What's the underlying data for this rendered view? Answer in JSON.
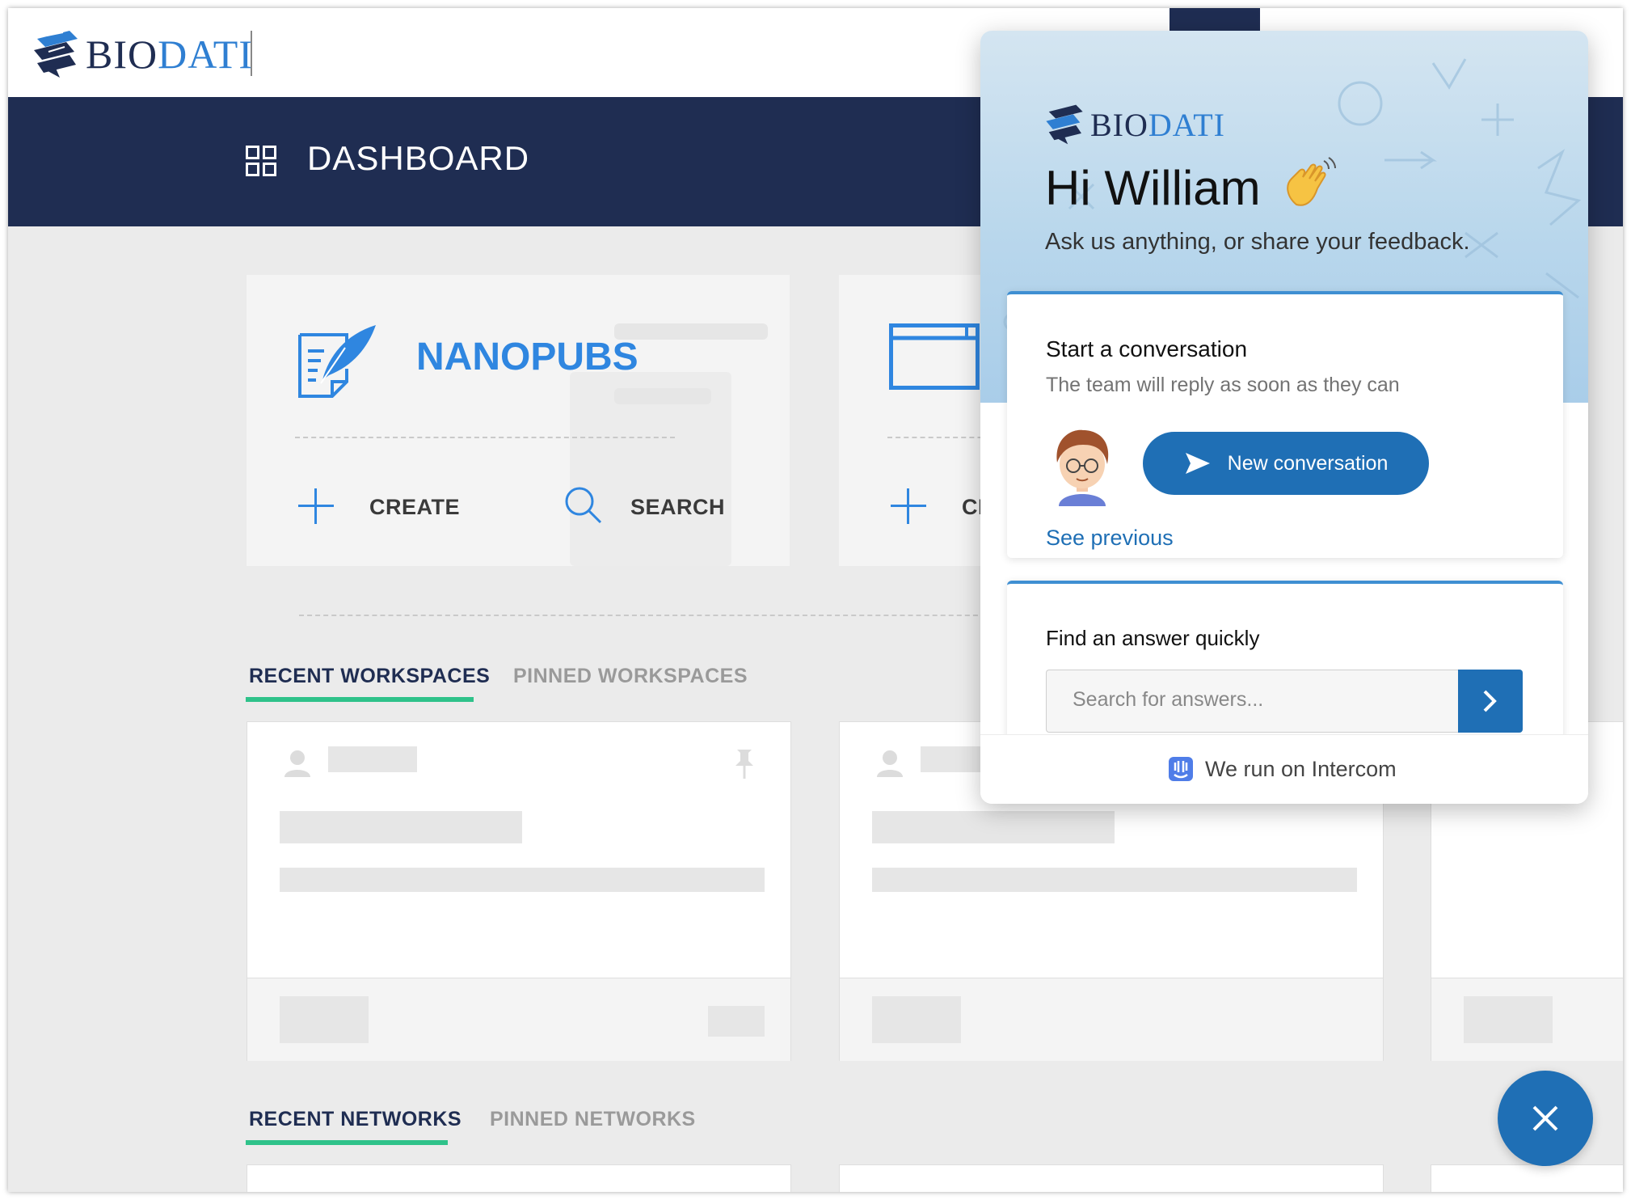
{
  "app": {
    "brand_part1": "BIO",
    "brand_part2": "DATI"
  },
  "header": {
    "title": "DASHBOARD"
  },
  "cards": [
    {
      "title": "NANOPUBS",
      "actions": [
        "CREATE",
        "SEARCH"
      ]
    },
    {
      "title": "",
      "actions": [
        "CRI"
      ]
    }
  ],
  "workspaces": {
    "tabs": [
      "RECENT WORKSPACES",
      "PINNED WORKSPACES"
    ],
    "active_tab": "RECENT WORKSPACES"
  },
  "networks": {
    "tabs": [
      "RECENT NETWORKS",
      "PINNED NETWORKS"
    ],
    "active_tab": "RECENT NETWORKS"
  },
  "intercom": {
    "greeting": "Hi William",
    "subtitle": "Ask us anything, or share your feedback.",
    "conversation": {
      "title": "Start a conversation",
      "subtitle": "The team will reply as soon as they can",
      "button_label": "New conversation",
      "see_previous": "See previous"
    },
    "find": {
      "title": "Find an answer quickly",
      "placeholder": "Search for answers..."
    },
    "footer": "We run on Intercom"
  },
  "colors": {
    "navy": "#1f2d52",
    "brand_blue": "#2f86e0",
    "intercom_blue": "#1f6fb5",
    "tab_underline": "#2fc28a"
  },
  "icons": [
    "dashboard-grid-icon",
    "nanopub-feather-icon",
    "plus-icon",
    "search-icon",
    "window-icon",
    "user-icon",
    "pin-icon",
    "wave-emoji-icon",
    "send-icon",
    "chevron-right-icon",
    "intercom-icon",
    "close-icon"
  ]
}
